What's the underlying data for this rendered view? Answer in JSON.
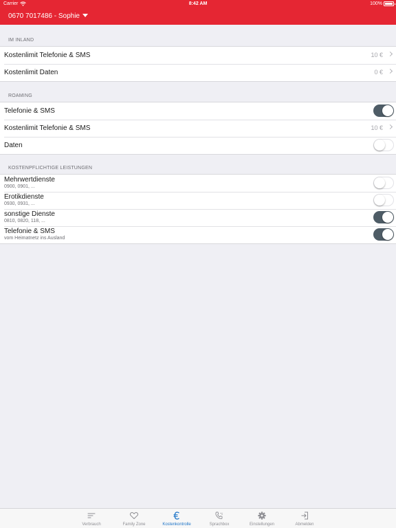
{
  "statusbar": {
    "carrier": "Carrier",
    "time": "8:42 AM",
    "battery": "100%"
  },
  "header": {
    "account": "0670 7017486 - Sophie"
  },
  "sections": {
    "inland": {
      "title": "IM INLAND",
      "rows": [
        {
          "label": "Kostenlimit Telefonie & SMS",
          "value": "10 €"
        },
        {
          "label": "Kostenlimit Daten",
          "value": "0 €"
        }
      ]
    },
    "roaming": {
      "title": "ROAMING",
      "rows": [
        {
          "label": "Telefonie & SMS",
          "toggle": true
        },
        {
          "label": "Kostenlimit Telefonie & SMS",
          "value": "10 €"
        },
        {
          "label": "Daten",
          "toggle": false
        }
      ]
    },
    "paid": {
      "title": "KOSTENPFLICHTIGE LEISTUNGEN",
      "rows": [
        {
          "label": "Mehrwertdienste",
          "sub": "0900, 0901, ...",
          "toggle": false
        },
        {
          "label": "Erotikdienste",
          "sub": "0930, 0931, ...",
          "toggle": false
        },
        {
          "label": "sonstige Dienste",
          "sub": "0810, 0820, 118, ...",
          "toggle": true
        },
        {
          "label": "Telefonie & SMS",
          "sub": "vom Heimatnetz ins Ausland",
          "toggle": true
        }
      ]
    }
  },
  "tabbar": {
    "active": "Kostenkontrolle",
    "tabs": [
      {
        "label": "Verbrauch",
        "icon": "usage-bars-icon"
      },
      {
        "label": "Family Zone",
        "icon": "heart-icon"
      },
      {
        "label": "Kostenkontrolle",
        "icon": "euro-icon"
      },
      {
        "label": "Sprachbox",
        "icon": "phone-voicemail-icon"
      },
      {
        "label": "Einstellungen",
        "icon": "gear-icon"
      },
      {
        "label": "Abmelden",
        "icon": "logout-icon"
      }
    ]
  },
  "colors": {
    "header": "#e52633",
    "toggle_on": "#4e5c66",
    "tab_active": "#1e74c7",
    "background": "#efeff4"
  }
}
